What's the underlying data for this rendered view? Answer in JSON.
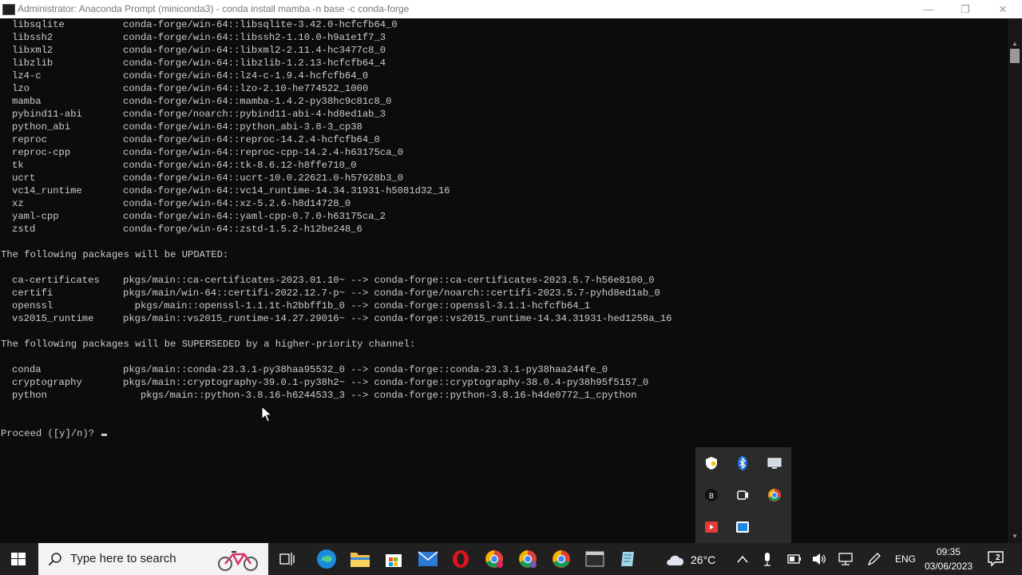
{
  "window": {
    "title": "Administrator: Anaconda Prompt (miniconda3) - conda  install mamba -n base -c conda-forge",
    "minimize": "—",
    "maximize": "❐",
    "close": "✕"
  },
  "console": {
    "new_packages": [
      {
        "name": "libsqlite",
        "spec": "conda-forge/win-64::libsqlite-3.42.0-hcfcfb64_0"
      },
      {
        "name": "libssh2",
        "spec": "conda-forge/win-64::libssh2-1.10.0-h9a1e1f7_3"
      },
      {
        "name": "libxml2",
        "spec": "conda-forge/win-64::libxml2-2.11.4-hc3477c8_0"
      },
      {
        "name": "libzlib",
        "spec": "conda-forge/win-64::libzlib-1.2.13-hcfcfb64_4"
      },
      {
        "name": "lz4-c",
        "spec": "conda-forge/win-64::lz4-c-1.9.4-hcfcfb64_0"
      },
      {
        "name": "lzo",
        "spec": "conda-forge/win-64::lzo-2.10-he774522_1000"
      },
      {
        "name": "mamba",
        "spec": "conda-forge/win-64::mamba-1.4.2-py38hc9c81c8_0"
      },
      {
        "name": "pybind11-abi",
        "spec": "conda-forge/noarch::pybind11-abi-4-hd8ed1ab_3"
      },
      {
        "name": "python_abi",
        "spec": "conda-forge/win-64::python_abi-3.8-3_cp38"
      },
      {
        "name": "reproc",
        "spec": "conda-forge/win-64::reproc-14.2.4-hcfcfb64_0"
      },
      {
        "name": "reproc-cpp",
        "spec": "conda-forge/win-64::reproc-cpp-14.2.4-h63175ca_0"
      },
      {
        "name": "tk",
        "spec": "conda-forge/win-64::tk-8.6.12-h8ffe710_0"
      },
      {
        "name": "ucrt",
        "spec": "conda-forge/win-64::ucrt-10.0.22621.0-h57928b3_0"
      },
      {
        "name": "vc14_runtime",
        "spec": "conda-forge/win-64::vc14_runtime-14.34.31931-h5081d32_16"
      },
      {
        "name": "xz",
        "spec": "conda-forge/win-64::xz-5.2.6-h8d14728_0"
      },
      {
        "name": "yaml-cpp",
        "spec": "conda-forge/win-64::yaml-cpp-0.7.0-h63175ca_2"
      },
      {
        "name": "zstd",
        "spec": "conda-forge/win-64::zstd-1.5.2-h12be248_6"
      }
    ],
    "updated_header": "The following packages will be UPDATED:",
    "updated_packages": [
      {
        "name": "ca-certificates",
        "spec": "pkgs/main::ca-certificates-2023.01.10~ --> conda-forge::ca-certificates-2023.5.7-h56e8100_0"
      },
      {
        "name": "certifi",
        "spec": "pkgs/main/win-64::certifi-2022.12.7-p~ --> conda-forge/noarch::certifi-2023.5.7-pyhd8ed1ab_0"
      },
      {
        "name": "openssl",
        "spec": "  pkgs/main::openssl-1.1.1t-h2bbff1b_0 --> conda-forge::openssl-3.1.1-hcfcfb64_1"
      },
      {
        "name": "vs2015_runtime",
        "spec": "pkgs/main::vs2015_runtime-14.27.29016~ --> conda-forge::vs2015_runtime-14.34.31931-hed1258a_16"
      }
    ],
    "superseded_header": "The following packages will be SUPERSEDED by a higher-priority channel:",
    "superseded_packages": [
      {
        "name": "conda",
        "spec": "pkgs/main::conda-23.3.1-py38haa95532_0 --> conda-forge::conda-23.3.1-py38haa244fe_0"
      },
      {
        "name": "cryptography",
        "spec": "pkgs/main::cryptography-39.0.1-py38h2~ --> conda-forge::cryptography-38.0.4-py38h95f5157_0"
      },
      {
        "name": "python",
        "spec": "   pkgs/main::python-3.8.16-h6244533_3 --> conda-forge::python-3.8.16-h4de0772_1_cpython"
      }
    ],
    "prompt": "Proceed ([y]/n)? "
  },
  "taskbar": {
    "search_placeholder": "Type here to search",
    "weather_temp": "26°C",
    "language": "ENG",
    "time": "09:35",
    "date": "03/06/2023",
    "notification_count": "2"
  },
  "icons": {
    "start": "windows-start-icon",
    "search": "magnifier-icon",
    "task_view": "task-view-icon",
    "edge": "edge-icon",
    "explorer": "file-explorer-icon",
    "store": "microsoft-store-icon",
    "mail": "mail-icon",
    "opera": "opera-icon",
    "chrome": "chrome-icon"
  }
}
